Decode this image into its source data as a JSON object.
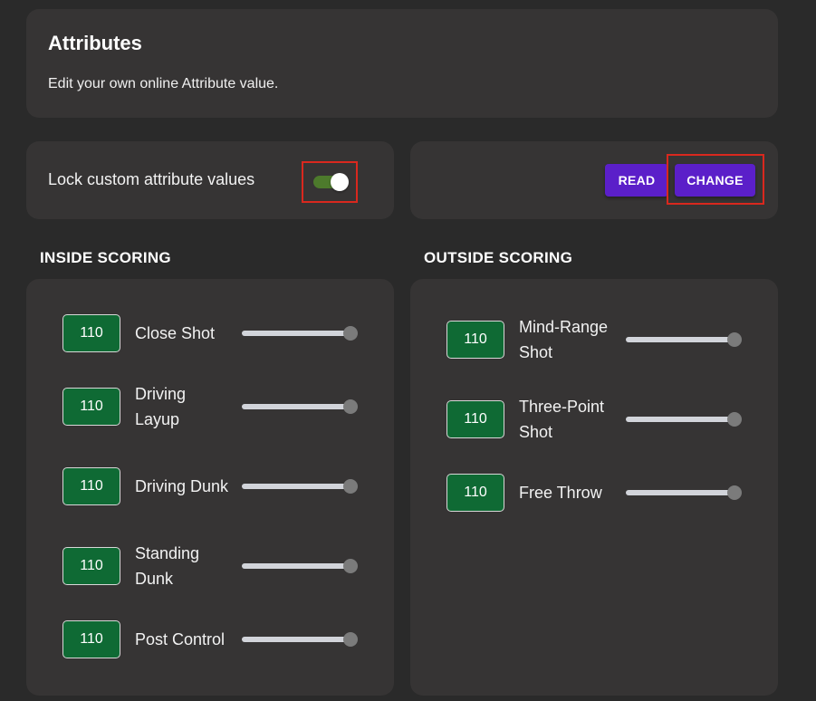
{
  "header": {
    "title": "Attributes",
    "subtitle": "Edit your own online Attribute value."
  },
  "lock": {
    "label": "Lock custom attribute values",
    "enabled": true
  },
  "mode_buttons": {
    "read_label": "READ",
    "change_label": "CHANGE"
  },
  "inside_scoring": {
    "title": "INSIDE SCORING",
    "items": [
      {
        "label": "Close Shot",
        "value": "110",
        "slider_fraction": 1.0
      },
      {
        "label": "Driving Layup",
        "value": "110",
        "slider_fraction": 1.0
      },
      {
        "label": "Driving Dunk",
        "value": "110",
        "slider_fraction": 1.0
      },
      {
        "label": "Standing Dunk",
        "value": "110",
        "slider_fraction": 1.0
      },
      {
        "label": "Post Control",
        "value": "110",
        "slider_fraction": 1.0
      }
    ]
  },
  "outside_scoring": {
    "title": "OUTSIDE SCORING",
    "items": [
      {
        "label": "Mind-Range Shot",
        "value": "110",
        "slider_fraction": 1.0
      },
      {
        "label": "Three-Point Shot",
        "value": "110",
        "slider_fraction": 1.0
      },
      {
        "label": "Free Throw",
        "value": "110",
        "slider_fraction": 1.0
      }
    ]
  },
  "colors": {
    "background": "#2a2a2a",
    "card": "#363434",
    "accent_purple": "#5b1fc9",
    "value_green": "#0f6a34",
    "toggle_on": "#4d7a2c",
    "highlight_red": "#d9281e"
  }
}
